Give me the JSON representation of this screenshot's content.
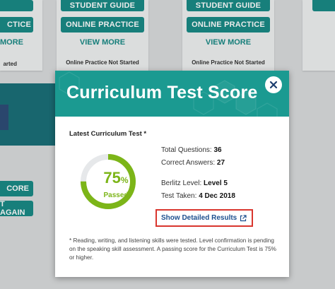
{
  "background": {
    "cards": [
      {
        "guide_label": "STUDENT GUIDE",
        "practice_label": "ONLINE PRACTICE",
        "view_more_label": "VIEW MORE",
        "status": "Online Practice Not Started"
      },
      {
        "guide_label": "STUDENT GUIDE",
        "practice_label": "ONLINE PRACTICE",
        "view_more_label": "VIEW MORE",
        "status": "Online Practice Not Started"
      }
    ],
    "left_card": {
      "practice_fragment": "CTICE",
      "view_more_fragment": "MORE",
      "status_fragment": "arted",
      "score_fragment": "CORE",
      "again_fragment": "T AGAIN"
    }
  },
  "modal": {
    "title": "Curriculum Test Score",
    "subtitle": "Latest Curriculum Test *",
    "score": {
      "percent": 75,
      "percent_symbol": "%",
      "status": "Passed"
    },
    "stats": {
      "total_questions_label": "Total Questions:",
      "total_questions": "36",
      "correct_answers_label": "Correct Answers:",
      "correct_answers": "27",
      "level_label": "Berlitz Level:",
      "level": "Level 5",
      "test_taken_label": "Test Taken:",
      "test_taken": "4 Dec 2018"
    },
    "detailed_link": "Show Detailed Results",
    "footnote": "* Reading, writing, and listening skills were tested. Level confirmation is pending on the speaking skill assessment. A passing score for the Curriculum Test is 75% or higher."
  },
  "colors": {
    "teal": "#1a8a86",
    "header_teal": "#1b9a91",
    "score_green": "#7cb518",
    "link_blue": "#1c4f8e",
    "highlight_red": "#d9362e"
  },
  "icons": {
    "close": "close-icon",
    "external": "external-link-icon"
  }
}
